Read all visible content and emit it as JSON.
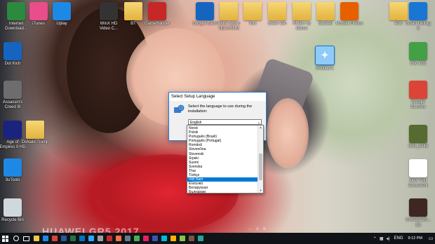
{
  "wallpaper": {
    "watermark": "HUAWEI GR5 2017"
  },
  "desktop_icons_top": [
    {
      "label": "Internet Download...",
      "icon": "idm-icon",
      "color": "#2b8a3e"
    },
    {
      "label": "iTunes",
      "icon": "itunes-icon",
      "color": "#e94d8a"
    },
    {
      "label": "Uplay",
      "icon": "uplay-icon",
      "color": "#1e88e5"
    },
    {
      "label": "WinX HD Video C...",
      "icon": "winx-icon",
      "color": "#333333"
    },
    {
      "label": "BT",
      "icon": "folder-icon",
      "color": "#e2b33f"
    },
    {
      "label": "GameRanger",
      "icon": "gameranger-icon",
      "color": "#c62828"
    },
    {
      "label": "Google Earth",
      "icon": "google-earth-icon",
      "color": "#1565c0"
    },
    {
      "label": "Work report TECHRUM",
      "icon": "folder-icon",
      "color": "#e2b33f"
    },
    {
      "label": "Tom",
      "icon": "folder-icon",
      "color": "#e2b33f"
    },
    {
      "label": "share văn",
      "icon": "folder-icon",
      "color": "#e2b33f"
    },
    {
      "label": "Nhiệm vụ Game",
      "icon": "folder-icon",
      "color": "#e2b33f"
    },
    {
      "label": "Backed",
      "icon": "folder-icon",
      "color": "#e2b33f"
    },
    {
      "label": "Mozilla Firefox",
      "icon": "firefox-icon",
      "color": "#e66000"
    },
    {
      "label": "Ảnh",
      "icon": "folder-icon",
      "color": "#e2b33f"
    }
  ],
  "desktop_icons_left": [
    {
      "label": "Dot Kich",
      "icon": "dotkich-icon",
      "color": "#1565c0"
    },
    {
      "label": "Assassin's Creed III",
      "icon": "assassins-creed-icon",
      "color": "#6d6d6d"
    },
    {
      "label": "Age of Empires II HD",
      "icon": "aoe-icon",
      "color": "#1a237e"
    },
    {
      "label": "DoNald Trump",
      "icon": "folder-icon",
      "color": "#e2b33f"
    },
    {
      "label": "3uTools",
      "icon": "3utools-icon",
      "color": "#1e88e5"
    },
    {
      "label": "Recycle Bin",
      "icon": "recycle-bin-icon",
      "color": "#cfd8dc"
    }
  ],
  "desktop_icons_right": [
    {
      "label": "Smart Defrag 5",
      "icon": "smart-defrag-icon",
      "color": "#1976d2"
    },
    {
      "label": "Cốc Cốc",
      "icon": "coccoc-icon",
      "color": "#43a047"
    },
    {
      "label": "Google Chrome",
      "icon": "chrome-icon",
      "color": "#db4437"
    },
    {
      "label": "IMG_0342",
      "icon": "image-icon",
      "color": "#556b2f"
    },
    {
      "label": "New Text Document",
      "icon": "text-document-icon",
      "color": "#ffffff"
    },
    {
      "label": "Crossfire20... (2)",
      "icon": "crossfire-icon",
      "color": "#3e2723"
    }
  ],
  "desktop_icon_mid": {
    "label": "Untitled-1",
    "icon": "shortcut-icon",
    "color": "#90caf9"
  },
  "dialog": {
    "title": "Select Setup Language",
    "prompt": "Select the language to use during the installation:",
    "selected": "English",
    "options": [
      "Norsk",
      "Polski",
      "Português (Brasil)",
      "Português (Portugal)",
      "Română",
      "Slovenčina",
      "Slovenski",
      "Srpski",
      "Suomi",
      "Svenska",
      "Thai",
      "Türkçe",
      "Việt Nam",
      "Ελληνικά",
      "Беларуская",
      "Български"
    ],
    "highlighted_index": 12
  },
  "taskbar": {
    "apps": [
      {
        "icon": "file-explorer-icon",
        "color": "#f2c94c"
      },
      {
        "icon": "edge-icon",
        "color": "#1e88e5"
      },
      {
        "icon": "chrome-taskbar-icon",
        "color": "#db4437"
      },
      {
        "icon": "word-icon",
        "color": "#2b579a"
      },
      {
        "icon": "excel-icon",
        "color": "#217346"
      },
      {
        "icon": "outlook-icon",
        "color": "#0072c6"
      },
      {
        "icon": "photoshop-icon",
        "color": "#31a8ff"
      },
      {
        "icon": "app-icon",
        "color": "#9e9e9e"
      },
      {
        "icon": "app-icon",
        "color": "#c62828"
      },
      {
        "icon": "app-icon",
        "color": "#ff7043"
      },
      {
        "icon": "app-icon",
        "color": "#607d8b"
      },
      {
        "icon": "app-icon",
        "color": "#4caf50"
      },
      {
        "icon": "app-icon",
        "color": "#e91e63"
      },
      {
        "icon": "app-icon",
        "color": "#3f51b5"
      },
      {
        "icon": "app-icon",
        "color": "#00bcd4"
      },
      {
        "icon": "app-icon",
        "color": "#ffb300"
      },
      {
        "icon": "app-icon",
        "color": "#8bc34a"
      },
      {
        "icon": "app-icon",
        "color": "#795548"
      },
      {
        "icon": "app-icon",
        "color": "#26a69a"
      }
    ],
    "language": "ENG",
    "time": "9:12 PM"
  }
}
